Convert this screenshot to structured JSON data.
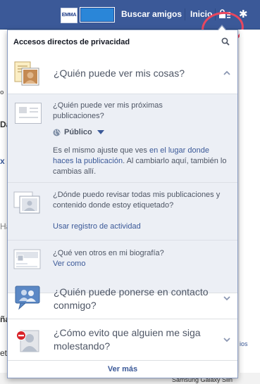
{
  "topbar": {
    "logo_text": "EMMA",
    "nav": {
      "find_friends": "Buscar amigos",
      "home": "Inicio"
    }
  },
  "background": {
    "left_fragments": [
      "o",
      "Da",
      "x",
      "Ha",
      "ña",
      "et"
    ],
    "right_fragment": "ios",
    "bottom_text": "Samsung Galaxy Slin"
  },
  "flyout": {
    "title": "Accesos directos de privacidad",
    "sections": [
      {
        "question": "¿Quién puede ver mis cosas?",
        "expanded": true
      },
      {
        "question": "¿Quién puede ponerse en contacto conmigo?",
        "expanded": false
      },
      {
        "question": "¿Cómo evito que alguien me siga molestando?",
        "expanded": false
      }
    ],
    "who_can_see": {
      "future_posts_question": "¿Quién puede ver mis próximas publicaciones?",
      "audience": "Público",
      "note_prefix": "Es el mismo ajuste que ves ",
      "note_link": "en el lugar donde haces la publicación",
      "note_suffix": ". Al cambiarlo aquí, también lo cambias allí.",
      "review_question": "¿Dónde puedo revisar todas mis publicaciones y contenido donde estoy etiquetado?",
      "review_link": "Usar registro de actividad",
      "timeline_question": "¿Qué ven otros en mi biografía?",
      "timeline_link": "Ver como"
    },
    "see_more": "Ver más"
  },
  "colors": {
    "topbar": "#3b5998",
    "link": "#3b5998",
    "highlight_circle": "#e8475f",
    "expanded_bg": "#eceff5"
  }
}
